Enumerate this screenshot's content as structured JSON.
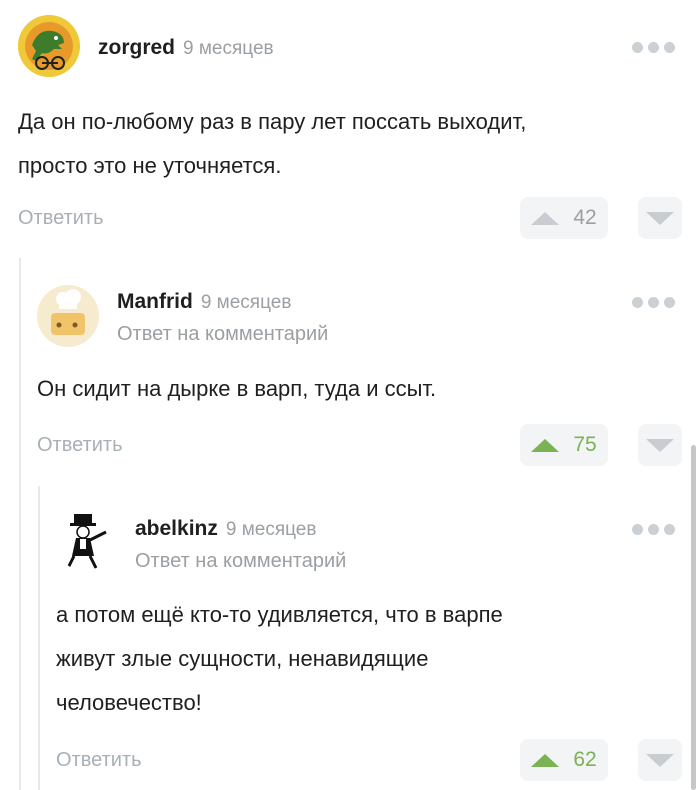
{
  "comments": [
    {
      "author": "zorgred",
      "time": "9 месяцев",
      "text_lines": [
        "Да он по-любому раз в пару лет поссать выходит,",
        "просто это не уточняется."
      ],
      "reply_label": "Ответить",
      "score": "42",
      "avatar": "dinosaur-avatar"
    },
    {
      "author": "Manfrid",
      "time": "9 месяцев",
      "reply_to_prefix": "Ответ на",
      "reply_to_link": "комментарий",
      "text_lines": [
        "Он сидит на дырке в варп, туда и ссыт."
      ],
      "reply_label": "Ответить",
      "score": "75",
      "avatar": "cheese-chef-avatar"
    },
    {
      "author": "abelkinz",
      "time": "9 месяцев",
      "reply_to_prefix": "Ответ на",
      "reply_to_link": "комментарий",
      "text_lines": [
        "а потом ещё кто-то удивляется, что в варпе",
        "живут злые сущности, ненавидящие",
        "человечество!"
      ],
      "reply_label": "Ответить",
      "score": "62",
      "avatar": "monopoly-man-avatar"
    }
  ],
  "colors": {
    "upvoted": "#7bb254",
    "muted": "#9a9fa3",
    "vote_bg": "#f3f4f5"
  }
}
